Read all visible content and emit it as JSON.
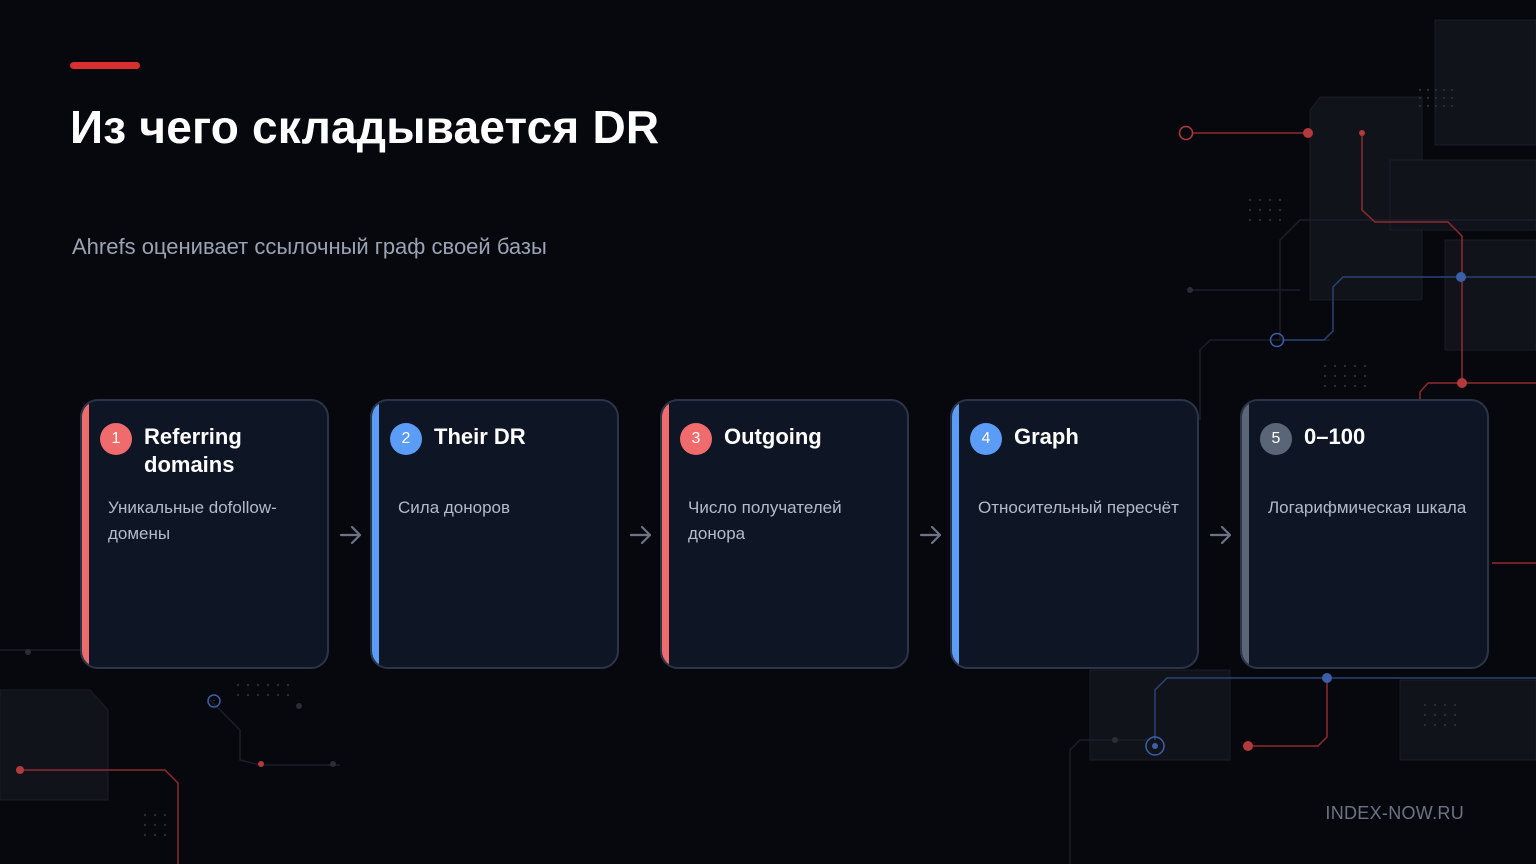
{
  "slide": {
    "title": "Из чего складывается DR",
    "subtitle": "Ahrefs оценивает ссылочный граф своей базы",
    "footer": "INDEX-NOW.RU"
  },
  "steps": [
    {
      "number": "1",
      "title": "Referring domains",
      "description": "Уникальные dofollow-домены",
      "accent": "#f06b6b"
    },
    {
      "number": "2",
      "title": "Their DR",
      "description": "Сила доноров",
      "accent": "#5b9cf6"
    },
    {
      "number": "3",
      "title": "Outgoing",
      "description": "Число получателей донора",
      "accent": "#f06b6b"
    },
    {
      "number": "4",
      "title": "Graph",
      "description": "Относительный пересчёт",
      "accent": "#5b9cf6"
    },
    {
      "number": "5",
      "title": "0–100",
      "description": "Логарифмическая шкала",
      "accent": "#5a6578"
    }
  ],
  "colors": {
    "background": "#07080d",
    "brand_red": "#d8302f",
    "card_bg": "#0e1524",
    "card_border": "#2c3548",
    "arrow": "#6b7385",
    "circuit_red": "#8e2a2e",
    "circuit_blue": "#2b4377"
  },
  "icons": {
    "connector": "arrow-right-icon"
  }
}
